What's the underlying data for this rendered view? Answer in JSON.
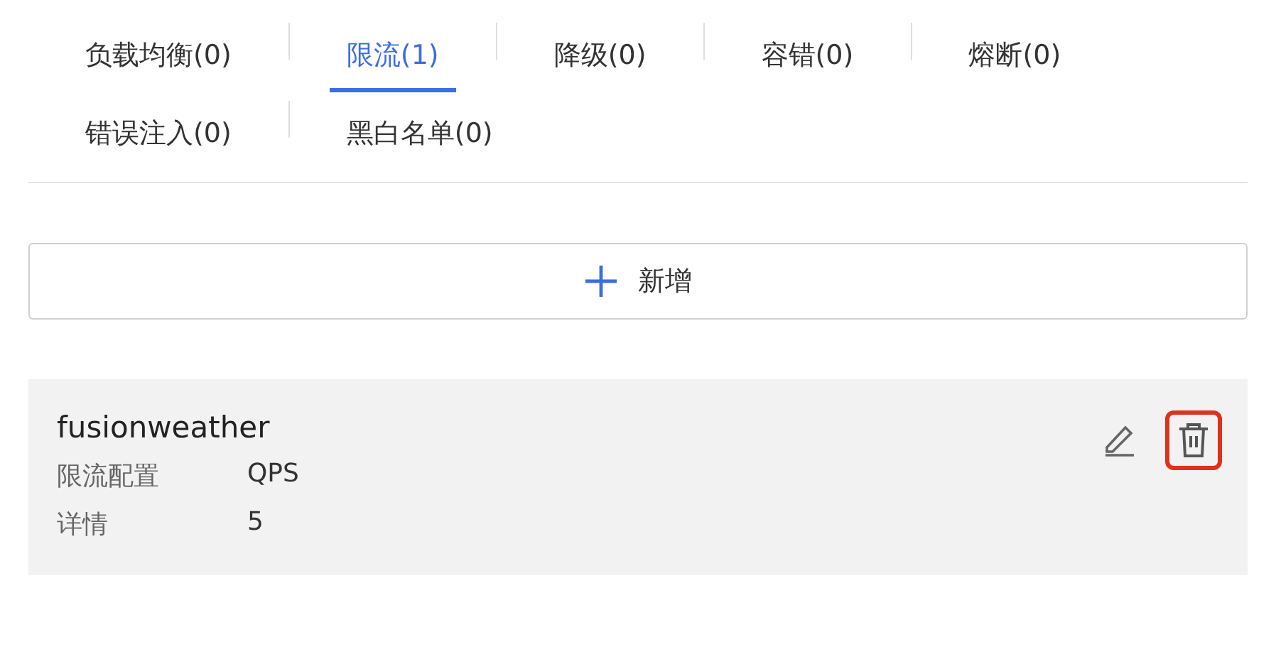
{
  "tabs": [
    {
      "label": "负载均衡(0)",
      "selected": false
    },
    {
      "label": "限流(1)",
      "selected": true
    },
    {
      "label": "降级(0)",
      "selected": false
    },
    {
      "label": "容错(0)",
      "selected": false
    },
    {
      "label": "熔断(0)",
      "selected": false
    },
    {
      "label": "错误注入(0)",
      "selected": false
    },
    {
      "label": "黑白名单(0)",
      "selected": false
    }
  ],
  "add_button": {
    "label": "新增"
  },
  "rules": [
    {
      "name": "fusionweather",
      "delete_highlighted": true,
      "fields": [
        {
          "label": "限流配置",
          "value": "QPS"
        },
        {
          "label": "详情",
          "value": "5"
        }
      ]
    }
  ]
}
